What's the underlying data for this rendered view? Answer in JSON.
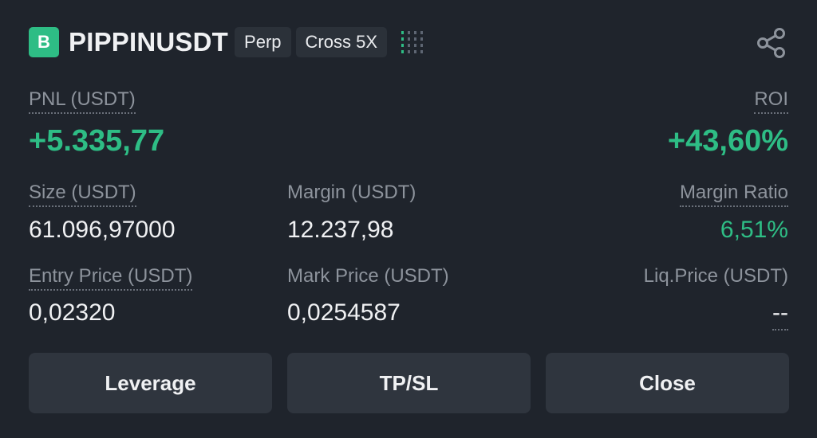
{
  "header": {
    "side_badge": "B",
    "symbol": "PIPPINUSDT",
    "tags": [
      "Perp",
      "Cross 5X"
    ],
    "risk_icon": "risk-level-bars-icon",
    "share_icon": "share-icon"
  },
  "pnl": {
    "label": "PNL (USDT)",
    "value": "+5.335,77"
  },
  "roi": {
    "label": "ROI",
    "value": "+43,60%"
  },
  "size": {
    "label": "Size (USDT)",
    "value": "61.096,97000"
  },
  "margin": {
    "label": "Margin (USDT)",
    "value": "12.237,98"
  },
  "margin_ratio": {
    "label": "Margin Ratio",
    "value": "6,51%"
  },
  "entry_price": {
    "label": "Entry Price (USDT)",
    "value": "0,02320"
  },
  "mark_price": {
    "label": "Mark Price (USDT)",
    "value": "0,0254587"
  },
  "liq_price": {
    "label": "Liq.Price (USDT)",
    "value": "--"
  },
  "buttons": {
    "leverage": "Leverage",
    "tpsl": "TP/SL",
    "close": "Close"
  },
  "colors": {
    "background": "#1f242c",
    "positive": "#2ebd85",
    "button_bg": "#2f353e",
    "tag_bg": "#2b3139",
    "muted_text": "#8d939c"
  }
}
